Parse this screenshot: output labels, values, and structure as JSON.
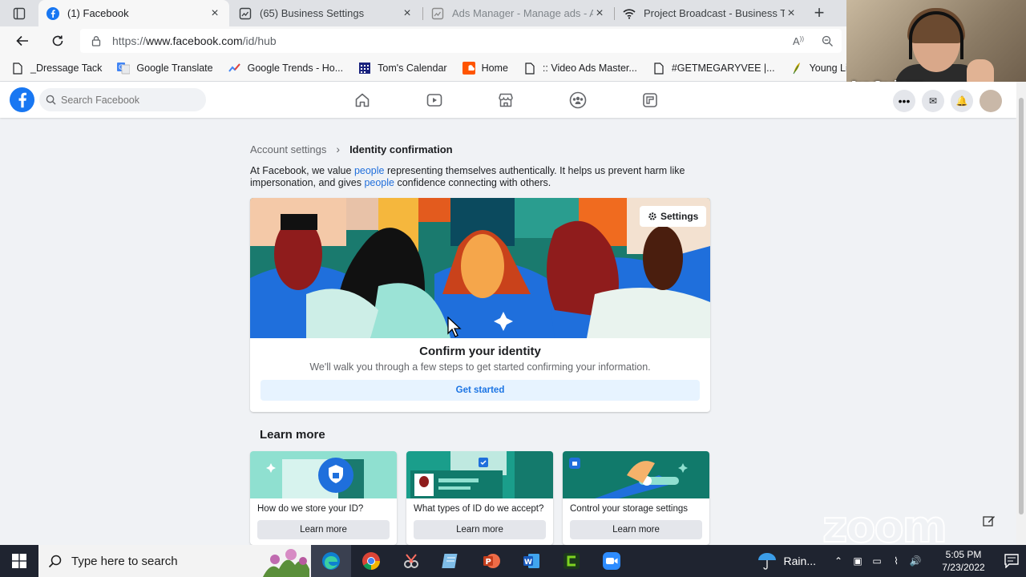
{
  "browser": {
    "tabs": [
      {
        "title": "(1) Facebook",
        "active": true,
        "icon": "facebook-icon"
      },
      {
        "title": "(65) Business Settings",
        "active": false,
        "icon": "business-settings-icon"
      },
      {
        "title": "Ads Manager - Manage ads - Ad",
        "active": false,
        "icon": "ads-manager-icon"
      },
      {
        "title": "Project Broadcast - Business Text",
        "active": false,
        "icon": "wifi-icon"
      }
    ],
    "url_prefix": "https://",
    "url_host": "www.facebook.com",
    "url_path": "/id/hub",
    "bookmarks": [
      {
        "label": "_Dressage Tack",
        "icon": "folder-icon"
      },
      {
        "label": "Google Translate",
        "icon": "translate-icon"
      },
      {
        "label": "Google Trends - Ho...",
        "icon": "trends-icon"
      },
      {
        "label": "Tom's Calendar",
        "icon": "calendar-icon"
      },
      {
        "label": "Home",
        "icon": "soundcloud-icon"
      },
      {
        "label": ":: Video Ads Master...",
        "icon": "page-icon"
      },
      {
        "label": "#GETMEGARYVEE |...",
        "icon": "page-icon"
      },
      {
        "label": "Young Living Virtua...",
        "icon": "leaf-icon"
      }
    ]
  },
  "zoom": {
    "participant_name": "Jen Springer",
    "logo": "zoom"
  },
  "facebook": {
    "search_placeholder": "Search Facebook",
    "breadcrumb": {
      "parent": "Account settings",
      "current": "Identity confirmation"
    },
    "intro": {
      "part1": "At Facebook, we value ",
      "link1": "people",
      "part2": " representing themselves authentically. It helps us prevent harm like impersonation, and gives ",
      "link2": "people",
      "part3": " confidence connecting with others."
    },
    "card": {
      "settings_label": "Settings",
      "title": "Confirm your identity",
      "subtitle": "We'll walk you through a few steps to get started confirming your information.",
      "button": "Get started"
    },
    "learn_more": {
      "heading": "Learn more",
      "items": [
        {
          "question": "How do we store your ID?",
          "button": "Learn more"
        },
        {
          "question": "What types of ID do we accept?",
          "button": "Learn more"
        },
        {
          "question": "Control your storage settings",
          "button": "Learn more"
        }
      ]
    }
  },
  "taskbar": {
    "search_placeholder": "Type here to search",
    "weather": "Rain...",
    "time": "5:05 PM",
    "date": "7/23/2022"
  },
  "colors": {
    "fb_blue": "#1877f2",
    "link_blue": "#216fdb",
    "page_bg": "#f0f2f5"
  }
}
